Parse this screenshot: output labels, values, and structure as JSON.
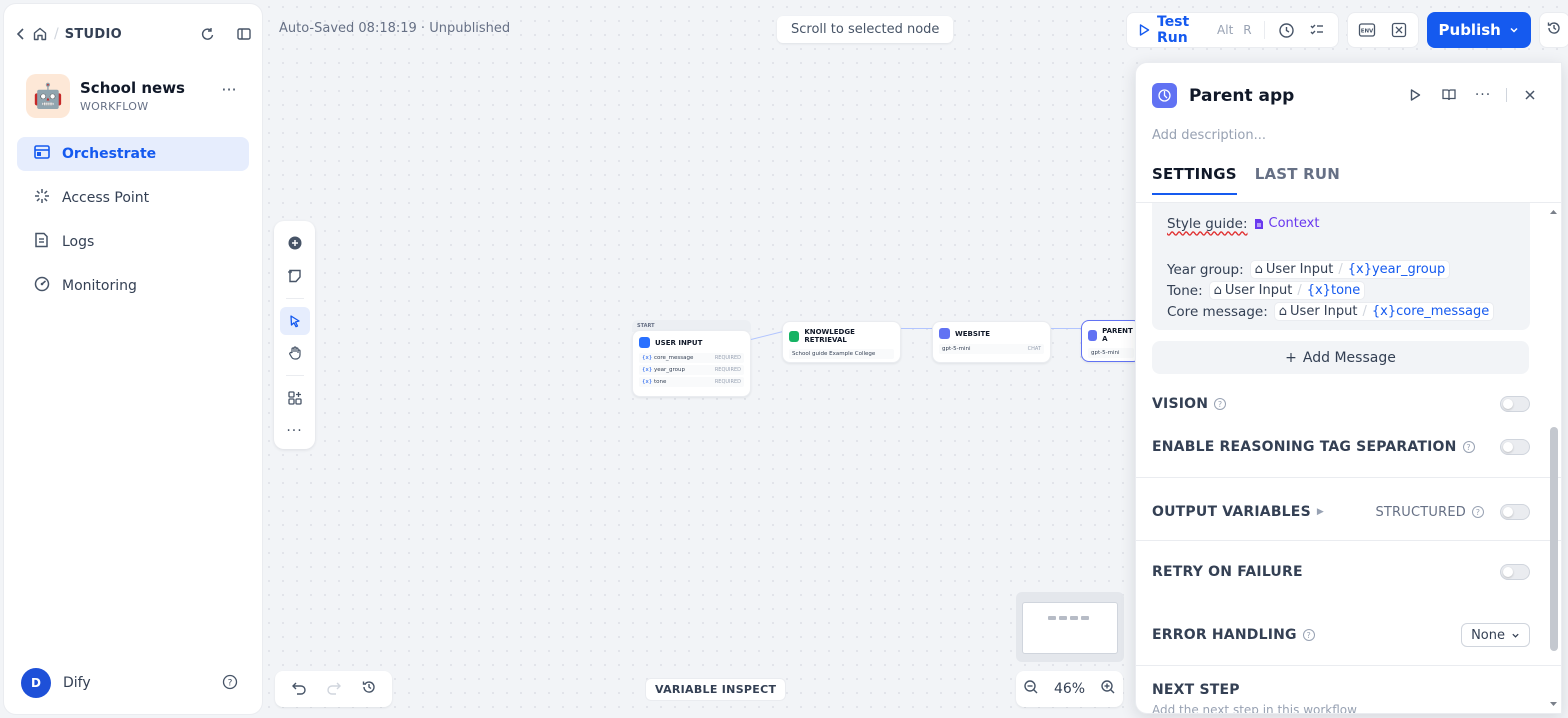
{
  "sidebar": {
    "crumb": "STUDIO",
    "app": {
      "name": "School news",
      "type": "WORKFLOW",
      "emoji": "🤖"
    },
    "nav": [
      {
        "label": "Orchestrate",
        "active": true
      },
      {
        "label": "Access Point"
      },
      {
        "label": "Logs"
      },
      {
        "label": "Monitoring"
      }
    ],
    "user": {
      "initial": "D",
      "name": "Dify"
    }
  },
  "header": {
    "autosave": "Auto-Saved 08:18:19 · Unpublished",
    "scroll_label": "Scroll to selected node",
    "test_run": "Test Run",
    "test_run_kbd1": "Alt",
    "test_run_kbd2": "R",
    "publish": "Publish"
  },
  "canvas": {
    "start_tag": "START",
    "nodes": {
      "user_input": {
        "title": "USER INPUT",
        "vars": [
          {
            "name": "core_message",
            "req": "REQUIRED"
          },
          {
            "name": "year_group",
            "req": "REQUIRED"
          },
          {
            "name": "tone",
            "req": "REQUIRED"
          }
        ]
      },
      "knowledge": {
        "title": "KNOWLEDGE RETRIEVAL",
        "detail": "School guide Example College"
      },
      "website": {
        "title": "WEBSITE",
        "model": "gpt-5-mini",
        "tag": "CHAT"
      },
      "parent": {
        "title": "PARENT A",
        "model": "gpt-5-mini"
      }
    },
    "variable_inspect": "VARIABLE INSPECT",
    "zoom": "46%",
    "accent": "#155aef"
  },
  "panel": {
    "title": "Parent app",
    "description_placeholder": "Add description...",
    "tabs": [
      "SETTINGS",
      "LAST RUN"
    ],
    "message": {
      "style_label": "Style guide:",
      "context": "Context",
      "lines": [
        {
          "label": "Year group:",
          "src": "User Input",
          "var": "year_group"
        },
        {
          "label": "Tone:",
          "src": "User Input",
          "var": "tone"
        },
        {
          "label": "Core message:",
          "src": "User Input",
          "var": "core_message"
        }
      ]
    },
    "add_message": "Add Message",
    "vision": "VISION",
    "reasoning": "ENABLE REASONING TAG SEPARATION",
    "output_vars": "OUTPUT VARIABLES",
    "structured": "STRUCTURED",
    "retry": "RETRY ON FAILURE",
    "error_handling": "ERROR HANDLING",
    "error_value": "None",
    "next_step": "NEXT STEP",
    "next_step_sub": "Add the next step in this workflow"
  }
}
